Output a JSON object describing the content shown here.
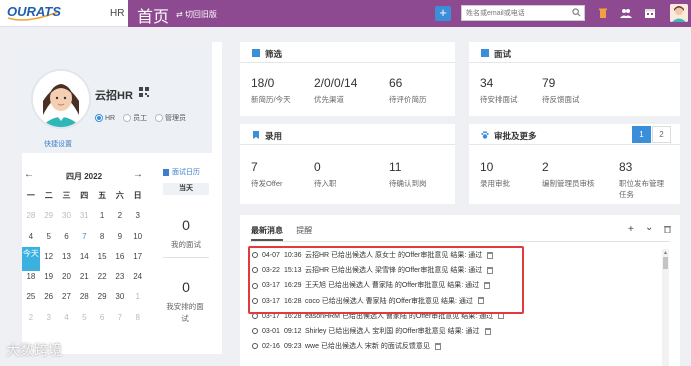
{
  "header": {
    "logo_text": "OURATS",
    "hr_label": "HR",
    "page_title": "首页",
    "switch_old_label": "切回旧版",
    "add_label": "+",
    "search_placeholder": "姓名或email或电话",
    "accent": "#8d4a90"
  },
  "profile": {
    "name": "云招HR",
    "roles": [
      {
        "label": "HR",
        "selected": true
      },
      {
        "label": "员工",
        "selected": false
      },
      {
        "label": "管理员",
        "selected": false
      }
    ],
    "quick_setup": "快捷设置"
  },
  "calendar": {
    "prev": "←",
    "month": "四月 2022",
    "next": "→",
    "weekdays": [
      "一",
      "二",
      "三",
      "四",
      "五",
      "六",
      "日"
    ],
    "weeks": [
      [
        "28",
        "29",
        "30",
        "31",
        "1",
        "2",
        "3"
      ],
      [
        "4",
        "5",
        "6",
        "7",
        "8",
        "9",
        "10"
      ],
      [
        "今天",
        "12",
        "13",
        "14",
        "15",
        "16",
        "17"
      ],
      [
        "18",
        "19",
        "20",
        "21",
        "22",
        "23",
        "24"
      ],
      [
        "25",
        "26",
        "27",
        "28",
        "29",
        "30",
        "1"
      ],
      [
        "2",
        "3",
        "4",
        "5",
        "6",
        "7",
        "8"
      ]
    ]
  },
  "schedule": {
    "tab": "面试日历",
    "today": "当天",
    "my_interviews_count": "0",
    "my_interviews_label": "我的面试",
    "my_arranged_count": "0",
    "my_arranged_label": "我安排的面试"
  },
  "filter_panel": {
    "title": "筛选",
    "stats": [
      {
        "value": "18/0",
        "label": "新简历/今天"
      },
      {
        "value": "2/0/0/14",
        "label": "优先渠道"
      },
      {
        "value": "66",
        "label": "待评价简历"
      }
    ]
  },
  "interview_panel": {
    "title": "面试",
    "stats": [
      {
        "value": "34",
        "label": "待安排面试"
      },
      {
        "value": "79",
        "label": "待反馈面试"
      }
    ]
  },
  "hire_panel": {
    "title": "录用",
    "stats": [
      {
        "value": "7",
        "label": "待发Offer"
      },
      {
        "value": "0",
        "label": "待入职"
      },
      {
        "value": "11",
        "label": "待确认到岗"
      }
    ]
  },
  "approval_panel": {
    "title": "审批及更多",
    "pages": [
      "1",
      "2"
    ],
    "stats": [
      {
        "value": "10",
        "label": "录用审批"
      },
      {
        "value": "2",
        "label": "编制管理员审核"
      },
      {
        "value": "83",
        "label": "职位发布管理任务"
      }
    ]
  },
  "news": {
    "tabs": [
      "最新消息",
      "提醒"
    ],
    "actions": {
      "add": "+",
      "expand": "⌄"
    },
    "items": [
      {
        "date": "04-07",
        "time": "10:36",
        "text": "云招HR 已给出候选人 原女士 的Offer审批意见 结果: 通过"
      },
      {
        "date": "03-22",
        "time": "15:13",
        "text": "云招HR 已给出候选人 梁雪锋 的Offer审批意见 结果: 通过"
      },
      {
        "date": "03-17",
        "time": "16:29",
        "text": "王天旭 已给出候选人 曹家陆 的Offer审批意见 结果: 通过"
      },
      {
        "date": "03-17",
        "time": "16:28",
        "text": "coco 已给出候选人 曹家陆 的Offer审批意见 结果: 通过"
      },
      {
        "date": "03-17",
        "time": "16:28",
        "text": "easonHRM 已给出候选人 曹家陆 的Offer审批意见 结果: 通过"
      },
      {
        "date": "03-01",
        "time": "09:12",
        "text": "Shirley 已给出候选人 宝利国 的Offer审批意见 结果: 通过"
      },
      {
        "date": "02-16",
        "time": "09:23",
        "text": "wwe 已给出候选人 宋新 的面试反馈意见"
      }
    ]
  },
  "watermark": "大数跨境"
}
